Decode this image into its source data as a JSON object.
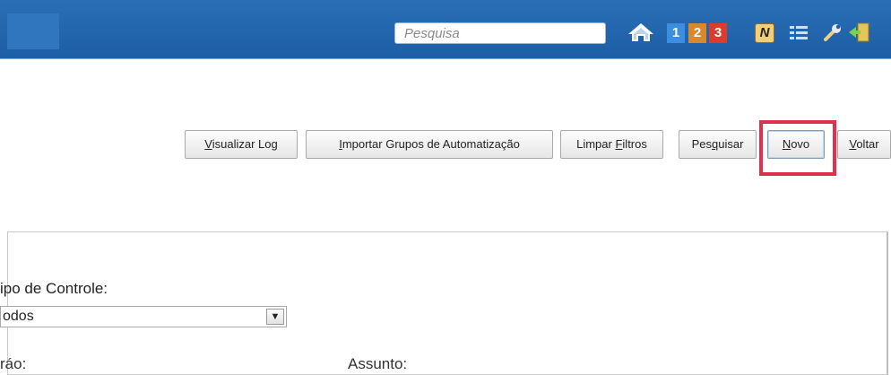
{
  "header": {
    "search_placeholder": "Pesquisa",
    "badges": [
      "1",
      "2",
      "3"
    ],
    "n_icon_label": "N"
  },
  "toolbar": {
    "visualizar_log": {
      "pre": "",
      "ul": "V",
      "post": "isualizar Log"
    },
    "importar": {
      "pre": "",
      "ul": "I",
      "post": "mportar Grupos de Automatização"
    },
    "limpar": {
      "pre": "Limpar ",
      "ul": "F",
      "post": "iltros"
    },
    "pesquisar": {
      "pre": "Pes",
      "ul": "q",
      "post": "uisar"
    },
    "novo": {
      "pre": "",
      "ul": "N",
      "post": "ovo"
    },
    "voltar": {
      "pre": "",
      "ul": "V",
      "post": "oltar"
    }
  },
  "filters": {
    "tipo_controle_label": "ipo de Controle:",
    "tipo_controle_value": "odos",
    "orgao_label_partial": "ráo:",
    "assunto_label_partial": "Assunto:"
  },
  "colors": {
    "header_bg": "#1d5ea6",
    "highlight": "#e0304e"
  }
}
